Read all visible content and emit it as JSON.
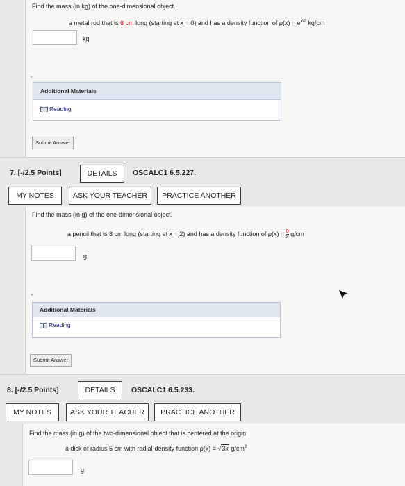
{
  "q6": {
    "prompt": "Find the mass (in kg) of the one-dimensional object.",
    "object_prefix": "a metal rod that is ",
    "length": "6 cm",
    "object_suffix": " long (starting at x = 0) and has a density function of ρ(x) = e",
    "exponent": "x/2",
    "density_unit": " kg/cm",
    "unit": "kg",
    "plus": "+",
    "additional_materials": "Additional Materials",
    "reading": "Reading",
    "submit": "Submit Answer"
  },
  "q7": {
    "number": "7.  [-/2.5 Points]",
    "details": "DETAILS",
    "course": "OSCALC1 6.5.227.",
    "my_notes": "MY NOTES",
    "ask_teacher": "ASK YOUR TEACHER",
    "practice": "PRACTICE ANOTHER",
    "prompt": "Find the mass (in g) of the one-dimensional object.",
    "object_text": "a pencil that is 8 cm long (starting at x = 2) and has a density function of ρ(x) = ",
    "frac_num": "8",
    "frac_den": "x",
    "density_unit": " g/cm",
    "unit": "g",
    "plus": "+",
    "additional_materials": "Additional Materials",
    "reading": "Reading",
    "submit": "Submit Answer"
  },
  "q8": {
    "number": "8.  [-/2.5 Points]",
    "details": "DETAILS",
    "course": "OSCALC1 6.5.233.",
    "my_notes": "MY NOTES",
    "ask_teacher": "ASK YOUR TEACHER",
    "practice": "PRACTICE ANOTHER",
    "prompt": "Find the mass (in g) of the two-dimensional object that is centered at the origin.",
    "object_text": "a disk of radius 5 cm with radial-density function ρ(x) = √",
    "sqrt_arg": "3x",
    "density_unit": " g/cm",
    "unit_exp": "2",
    "unit": "g"
  }
}
